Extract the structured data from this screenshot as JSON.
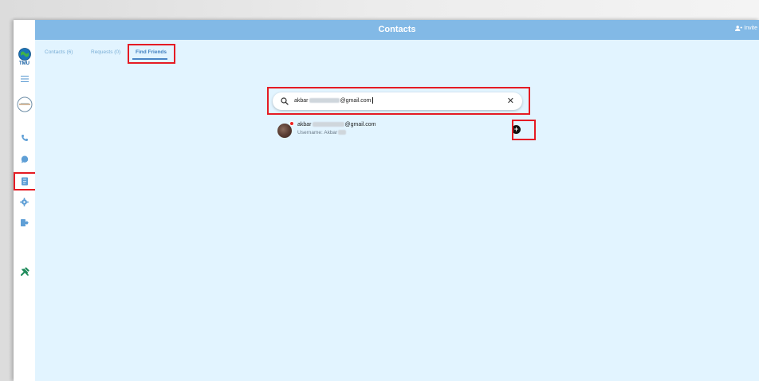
{
  "window": {
    "title": "Contacts"
  },
  "header": {
    "invite_label": "Invite"
  },
  "tabs": [
    {
      "label": "Contacts (6)",
      "active": false
    },
    {
      "label": "Requests (0)",
      "active": false
    },
    {
      "label": "Find Friends",
      "active": true
    }
  ],
  "search": {
    "value_prefix": "akbar",
    "value_suffix": "@gmail.com",
    "clear_icon": "close-icon"
  },
  "result": {
    "email_prefix": "akbar",
    "email_suffix": "@gmail.com",
    "username_label": "Username: Akbar",
    "add_icon": "plus-circle-icon"
  },
  "sidebar": {
    "logo_text": "TMU",
    "items": [
      "menu-icon",
      "avatar",
      "phone-icon",
      "chat-icon",
      "contacts-icon",
      "settings-icon",
      "logout-icon",
      "tools-icon"
    ]
  },
  "colors": {
    "titlebar": "#82b9e6",
    "background": "#e2f4ff",
    "highlight": "#e51b24",
    "accent": "#3f7fc0"
  }
}
